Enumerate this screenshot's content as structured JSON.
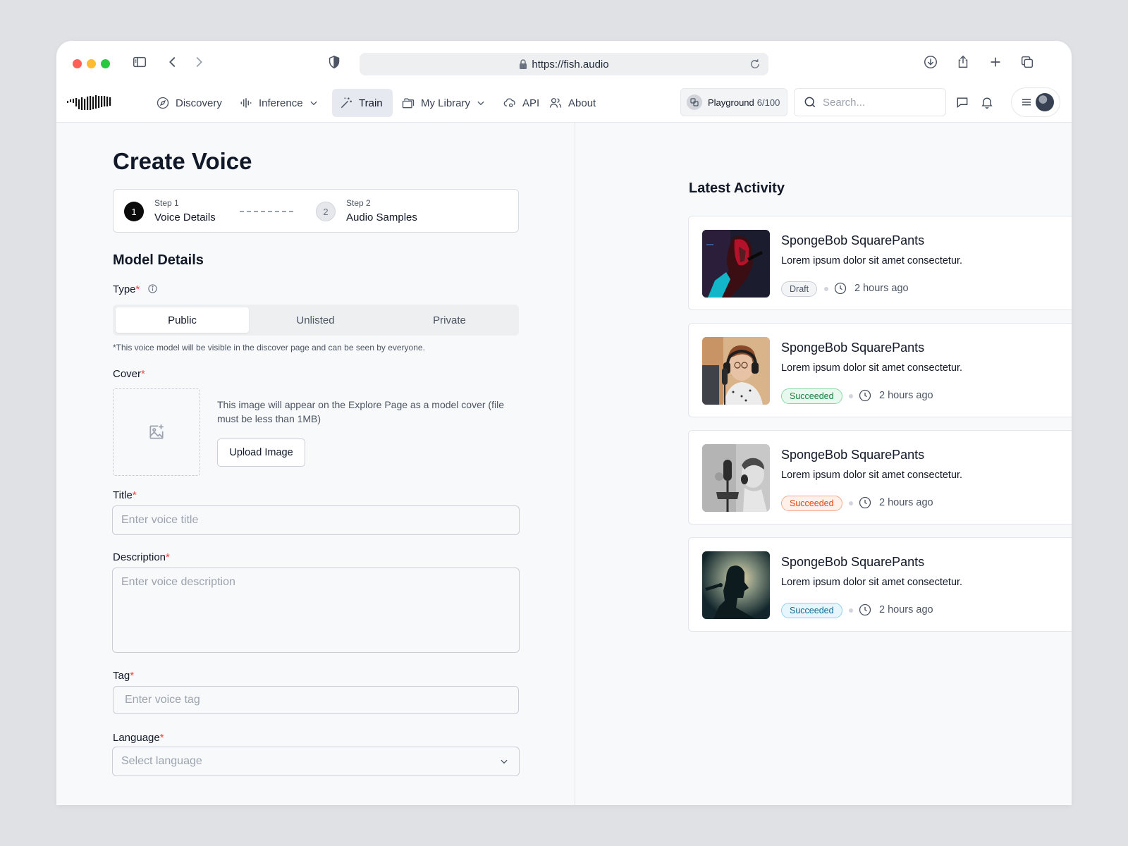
{
  "browser": {
    "url": "https://fish.audio"
  },
  "nav": {
    "items": [
      {
        "label": "Discovery",
        "icon": "compass-icon"
      },
      {
        "label": "Inference",
        "icon": "waveform-icon"
      },
      {
        "label": "Train",
        "icon": "magic-wand-icon",
        "active": true
      },
      {
        "label": "My Library",
        "icon": "folder-icon"
      },
      {
        "label": "API",
        "icon": "cloud-gear-icon"
      },
      {
        "label": "About",
        "icon": "users-icon"
      }
    ],
    "playground_label": "Playground",
    "playground_count": "6/100",
    "search_placeholder": "Search..."
  },
  "form": {
    "title": "Create Voice",
    "steps": [
      {
        "number": "1",
        "small": "Step 1",
        "label": "Voice Details",
        "active": true
      },
      {
        "number": "2",
        "small": "Step 2",
        "label": "Audio Samples",
        "active": false
      }
    ],
    "section_title": "Model Details",
    "type_label": "Type",
    "type_options": [
      "Public",
      "Unlisted",
      "Private"
    ],
    "type_selected": "Public",
    "type_hint": "*This voice model will be visible in the discover page and can be seen by everyone.",
    "cover_label": "Cover",
    "cover_description": "This image will appear on the Explore Page as a model cover (file must be less than 1MB)",
    "upload_button": "Upload Image",
    "title_label": "Title",
    "title_placeholder": "Enter voice title",
    "description_label": "Description",
    "description_placeholder": "Enter voice description",
    "tag_label": "Tag",
    "tag_placeholder": "Enter voice tag",
    "language_label": "Language",
    "language_placeholder": "Select language",
    "required_mark": "*"
  },
  "activity": {
    "title": "Latest Activity",
    "items": [
      {
        "title": "SpongeBob SquarePants",
        "description": "Lorem ipsum dolor sit amet consectetur.",
        "status": "Draft",
        "status_color": "#4b5563",
        "time": "2 hours ago"
      },
      {
        "title": "SpongeBob SquarePants",
        "description": "Lorem ipsum dolor sit amet consectetur.",
        "status": "Succeeded",
        "status_color": "#15803d",
        "time": "2 hours ago"
      },
      {
        "title": "SpongeBob SquarePants",
        "description": "Lorem ipsum dolor sit amet consectetur.",
        "status": "Succeeded",
        "status_color": "#d9480f",
        "time": "2 hours ago"
      },
      {
        "title": "SpongeBob SquarePants",
        "description": "Lorem ipsum dolor sit amet consectetur.",
        "status": "Succeeded",
        "status_color": "#0b6a91",
        "time": "2 hours ago"
      }
    ]
  }
}
